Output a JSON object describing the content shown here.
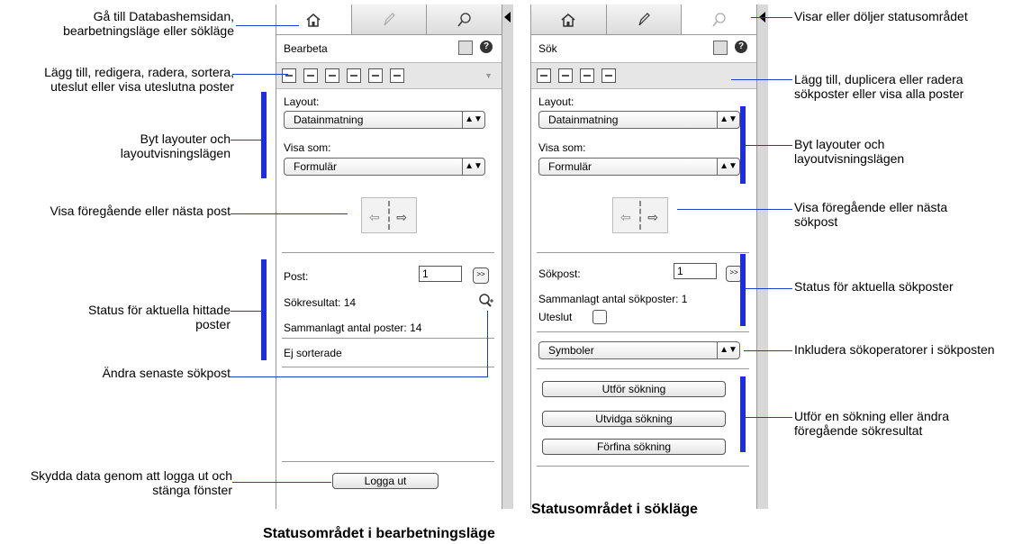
{
  "browse_panel": {
    "mode_label": "Bearbeta",
    "layout_label": "Layout:",
    "layout_value": "Datainmatning",
    "view_label": "Visa som:",
    "view_value": "Formulär",
    "record_label": "Post:",
    "record_value": "1",
    "found_label": "Sökresultat: 14",
    "total_label": "Sammanlagt antal poster: 14",
    "sort_label": "Ej sorterade",
    "logout_label": "Logga ut"
  },
  "find_panel": {
    "mode_label": "Sök",
    "layout_label": "Layout:",
    "layout_value": "Datainmatning",
    "view_label": "Visa som:",
    "view_value": "Formulär",
    "request_label": "Sökpost:",
    "request_value": "1",
    "total_requests": "Sammanlagt antal sökposter: 1",
    "omit_label": "Uteslut",
    "symbols_value": "Symboler",
    "perform_label": "Utför sökning",
    "extend_label": "Utvidga sökning",
    "constrain_label": "Förfina sökning"
  },
  "callouts_left": {
    "c1": "Gå till Databashemsidan, bearbetningsläge eller sökläge",
    "c2": "Lägg till, redigera, radera, sortera, uteslut eller visa uteslutna poster",
    "c3": "Byt layouter och layoutvisningslägen",
    "c4": "Visa föregående eller nästa post",
    "c5": "Status för aktuella hittade poster",
    "c6": "Ändra senaste sökpost",
    "c7": "Skydda data genom att logga ut och stänga fönster"
  },
  "callouts_right": {
    "r1": "Visar eller döljer statusområdet",
    "r2": "Lägg till, duplicera eller radera sökposter eller visa alla poster",
    "r3": "Byt layouter och layoutvisningslägen",
    "r4": "Visa föregående eller nästa sökpost",
    "r5": "Status för aktuella sökposter",
    "r6": "Inkludera sökoperatorer i sökposten",
    "r7": "Utför en sökning eller ändra föregående sökresultat"
  },
  "captions": {
    "find": "Statusområdet i sökläge",
    "browse": "Statusområdet i bearbetningsläge"
  },
  "colors": {
    "callout_line": "#1a3ccf",
    "bracket": "#1f2de0"
  }
}
